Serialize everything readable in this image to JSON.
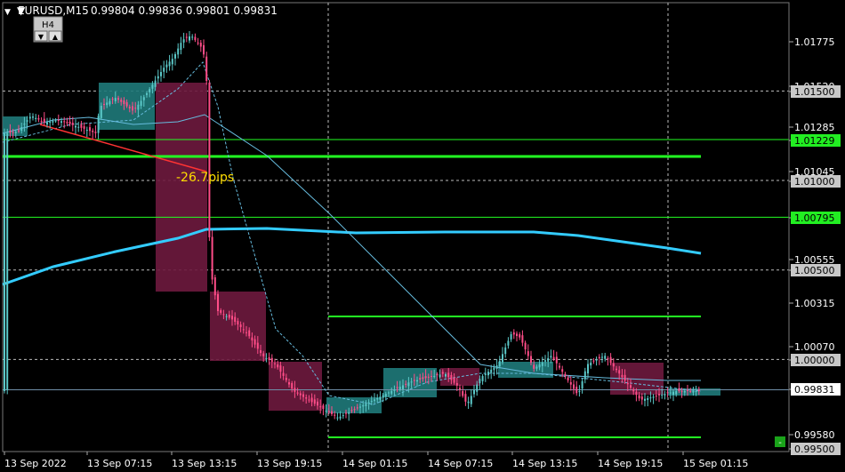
{
  "header": {
    "menu_arrow": "▼",
    "symbol": "EURUSD,M15",
    "ohlc": "0.99804 0.99836 0.99801 0.99831"
  },
  "tf_widget": {
    "label": "H4",
    "down": "▼",
    "up": "▲"
  },
  "price_annotation": "-26.7pips",
  "corner_badge": "-",
  "price_axis": [
    {
      "label": "1.01775",
      "style": "plain"
    },
    {
      "label": "1.01520",
      "style": "plain"
    },
    {
      "label": "1.01500",
      "style": "boxed"
    },
    {
      "label": "1.01285",
      "style": "plain"
    },
    {
      "label": "1.01229",
      "style": "green"
    },
    {
      "label": "1.01045",
      "style": "plain"
    },
    {
      "label": "1.01000",
      "style": "boxed"
    },
    {
      "label": "1.00795",
      "style": "green"
    },
    {
      "label": "1.00555",
      "style": "plain"
    },
    {
      "label": "1.00500",
      "style": "boxed"
    },
    {
      "label": "1.00315",
      "style": "plain"
    },
    {
      "label": "1.00070",
      "style": "plain"
    },
    {
      "label": "1.00000",
      "style": "boxed"
    },
    {
      "label": "0.99831",
      "style": "current"
    },
    {
      "label": "0.99580",
      "style": "plain"
    },
    {
      "label": "0.99500",
      "style": "boxed"
    }
  ],
  "time_axis": [
    "13 Sep 2022",
    "13 Sep 07:15",
    "13 Sep 13:15",
    "13 Sep 19:15",
    "14 Sep 01:15",
    "14 Sep 07:15",
    "14 Sep 13:15",
    "14 Sep 19:15",
    "15 Sep 01:15"
  ],
  "colors": {
    "background": "#000000",
    "bull_candle": "#5bc8c8",
    "bear_candle": "#ff4d88",
    "bull_box": "#1f7a7a",
    "bear_box": "#6e1a3e",
    "level_line": "#22ff22",
    "ma_slow": "#33ccff",
    "trend_line": "#ff3333",
    "annotation": "#ffdd00",
    "axis_text": "#ffffff"
  }
}
